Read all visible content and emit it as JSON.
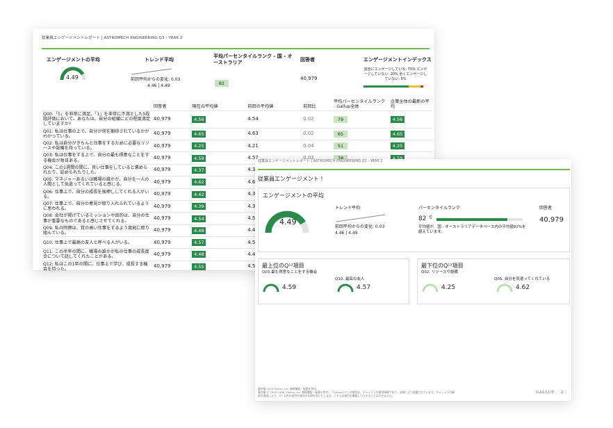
{
  "colors": {
    "accent_green": "#7ab648",
    "dark_green": "#2a8a4a",
    "light_green": "#c9e6c0",
    "yellow": "#e9c23a",
    "red": "#c0392b"
  },
  "page1": {
    "header": "従業員エンゲージメントレポート | ASTROMECH ENGINEERING Q3 - YEAR 2",
    "summary": {
      "avg_label": "エンゲージメントの平均",
      "avg_value": "4.49",
      "trend_label": "トレンド平均",
      "trend_change": "前回平均からの変化: 0.03",
      "trend_values": "4.46 | 4.49",
      "rank_label": "平均パーセンタイルランク - 国 - オーストラリア",
      "rank_value": "82",
      "respondents_label": "回答者",
      "respondents_value": "40,979",
      "index_label": "エンゲージメントインデックス",
      "index_text": "完全にエンゲージしている: 75% エンゲージしていない: 20% 全くエンゲージしていない: 5%",
      "index_engaged": 75,
      "index_not_engaged": 20,
      "index_actively_disengaged": 5
    },
    "table": {
      "headers": [
        "回答者",
        "現在の平均値",
        "前回の平均値",
        "前回比",
        "平均パーセンタイルランク - Gallup全体",
        "企業全体の最新の平均"
      ],
      "rows": [
        {
          "q": "Q00:「5」を非常に満足、「1」を非常に不満とした5段階評価において、あなたは、自分の組織にどの程度満足していますか?",
          "n": "40,979",
          "cur": "4.56",
          "prev": "4.54",
          "diff": "0.02",
          "pct": "79",
          "co": "4.56"
        },
        {
          "q": "Q01: 私は仕事の上で、自分が何を期待されているかがわかっている。",
          "n": "40,979",
          "cur": "4.65",
          "prev": "4.63",
          "diff": "0.02",
          "pct": "65",
          "co": "4.65"
        },
        {
          "q": "Q02: 私は自分がきちんと仕事をするために必要なリソースや設備を持っている。",
          "n": "40,979",
          "cur": "4.25",
          "prev": "4.21",
          "diff": "0.04",
          "pct": "51",
          "co": "4.25"
        },
        {
          "q": "Q03: 私は仕事をする上で、自分の最も得意なことをする機会が毎日ある。",
          "n": "40,979",
          "cur": "4.59",
          "prev": "4.57",
          "diff": "0.02",
          "pct": "78",
          "co": "4.59"
        },
        {
          "q": "Q04: この1週間の間に、良い仕事をしていると褒められたり、認められたりした。",
          "n": "40,979",
          "cur": "4.37",
          "prev": "4.33",
          "diff": "",
          "pct": "",
          "co": ""
        },
        {
          "q": "Q05: マネジャーあるいは職場の誰かが、自分を一人の人間として気遣ってくれていると感じる。",
          "n": "40,979",
          "cur": "4.62",
          "prev": "4.60",
          "diff": "",
          "pct": "",
          "co": ""
        },
        {
          "q": "Q06: 仕事上で、自分の成長を後押ししてくれる人がいる。",
          "n": "40,979",
          "cur": "4.42",
          "prev": "4.39",
          "diff": "",
          "pct": "",
          "co": ""
        },
        {
          "q": "Q07: 仕事上で、自分の意見が取り入れられているように思われる。",
          "n": "40,979",
          "cur": "4.39",
          "prev": "4.36",
          "diff": "",
          "pct": "",
          "co": ""
        },
        {
          "q": "Q08: 会社が掲げているミッションや目的は、自分の仕事が重要なものであると感じさせてくれる。",
          "n": "40,979",
          "cur": "4.54",
          "prev": "4.51",
          "diff": "",
          "pct": "",
          "co": ""
        },
        {
          "q": "Q09: 私の同僚は、質の高い仕事をするよう真剣に取り組んでいる。",
          "n": "40,979",
          "cur": "4.48",
          "prev": "4.45",
          "diff": "",
          "pct": "",
          "co": ""
        },
        {
          "q": "Q10: 仕事上で最高の友人と呼べる人がいる。",
          "n": "40,979",
          "cur": "4.57",
          "prev": "4.55",
          "diff": "",
          "pct": "",
          "co": ""
        },
        {
          "q": "Q11: この半年の間に、職場の誰かが私の仕事の成長度合について話してくれたことがある。",
          "n": "40,979",
          "cur": "4.48",
          "prev": "4.45",
          "diff": "",
          "pct": "",
          "co": ""
        },
        {
          "q": "Q12: 私はこの1年の間に、仕事上で学び、成長する機会を持った。",
          "n": "40,979",
          "cur": "4.55",
          "prev": "4.53",
          "diff": "",
          "pct": "",
          "co": ""
        }
      ]
    }
  },
  "page2": {
    "header": "従業員エンゲージメントレポート | ASTROMECH ENGINEERING Q3 - YEAR 2",
    "title": "従業員エンゲージメント !",
    "avg_card": {
      "title": "エンゲージメントの平均",
      "avg_value": "4.49",
      "trend_label": "トレンド平均",
      "trend_change": "前回平均からの変化: 0.03",
      "trend_values": "4.46 | 4.49",
      "pct_label": "パーセンタイルランク",
      "pct_value": "82",
      "pct_unit": "位",
      "pct_fraction": 0.82,
      "pct_note": "平均値が、国 - オーストラリアデータベース内の平均値82%を超えています。",
      "respondents_label": "回答者",
      "respondents_value": "40,979"
    },
    "top": {
      "title": "最上位のQ¹²項目",
      "items": [
        {
          "label": "Q03.最も得意なことをする機会",
          "value": "4.59"
        },
        {
          "label": "Q10. 最高の友人",
          "value": "4.57"
        }
      ]
    },
    "bottom": {
      "title": "最下位のQ¹²項目",
      "items": [
        {
          "label": "Q02. リソースや設備",
          "value": "4.25"
        },
        {
          "label": "Q05. 自分を気遣ってくれている",
          "value": "4.62"
        }
      ]
    },
    "footer_line1": "著作権 2020 Gallup, Inc. 無断複製・転載を禁ず。",
    "footer_line2": "著作権 © 1993-1998, Gallup, Inc. 無断複製・転載を禁ず。「Gallup Q¹²」の項目は、チャッシンの運用情報であり、法律により保護されています。チャッシンの事",
    "footer_line3": "前の書面により、Q¹² 以外の項目を使用する際を用いたします。これらの項目を複製したりすることはできません。",
    "brand": "GALLUP",
    "page_num": "2"
  }
}
